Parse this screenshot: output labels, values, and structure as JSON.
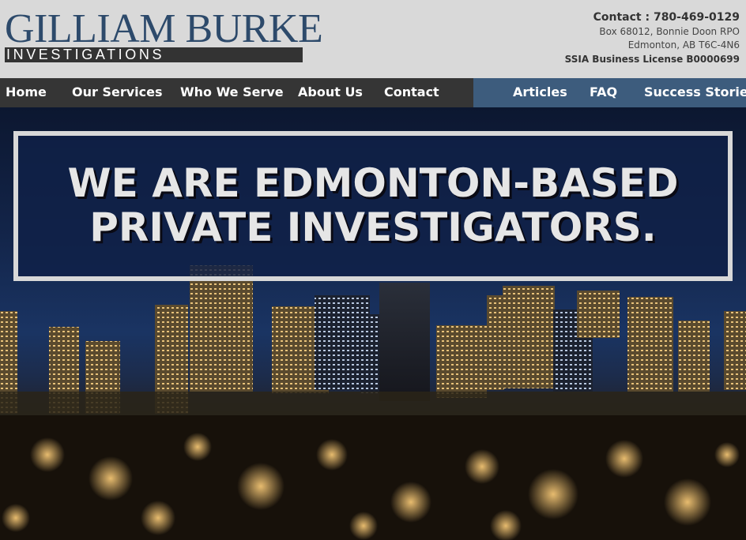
{
  "logo": {
    "name": "GILLIAM BURKE",
    "tagline": "INVESTIGATIONS"
  },
  "contact": {
    "phone_label": "Contact :",
    "phone": "780-469-0129",
    "address_line1": "Box 68012, Bonnie Doon RPO",
    "address_line2": "Edmonton, AB T6C-4N6",
    "license": "SSIA Business License B0000699"
  },
  "nav": {
    "left": [
      "Home",
      "Our Services",
      "Who We Serve",
      "About Us",
      "Contact"
    ],
    "right": [
      "Articles",
      "FAQ",
      "Success Stories"
    ]
  },
  "hero": {
    "line1": "WE ARE EDMONTON-BASED",
    "line2": "PRIVATE INVESTIGATORS."
  },
  "colors": {
    "brand_blue": "#2d4a6b",
    "nav_dark": "#353535",
    "nav_blue": "#3d5c7d",
    "header_bg": "#d9d9d9"
  }
}
